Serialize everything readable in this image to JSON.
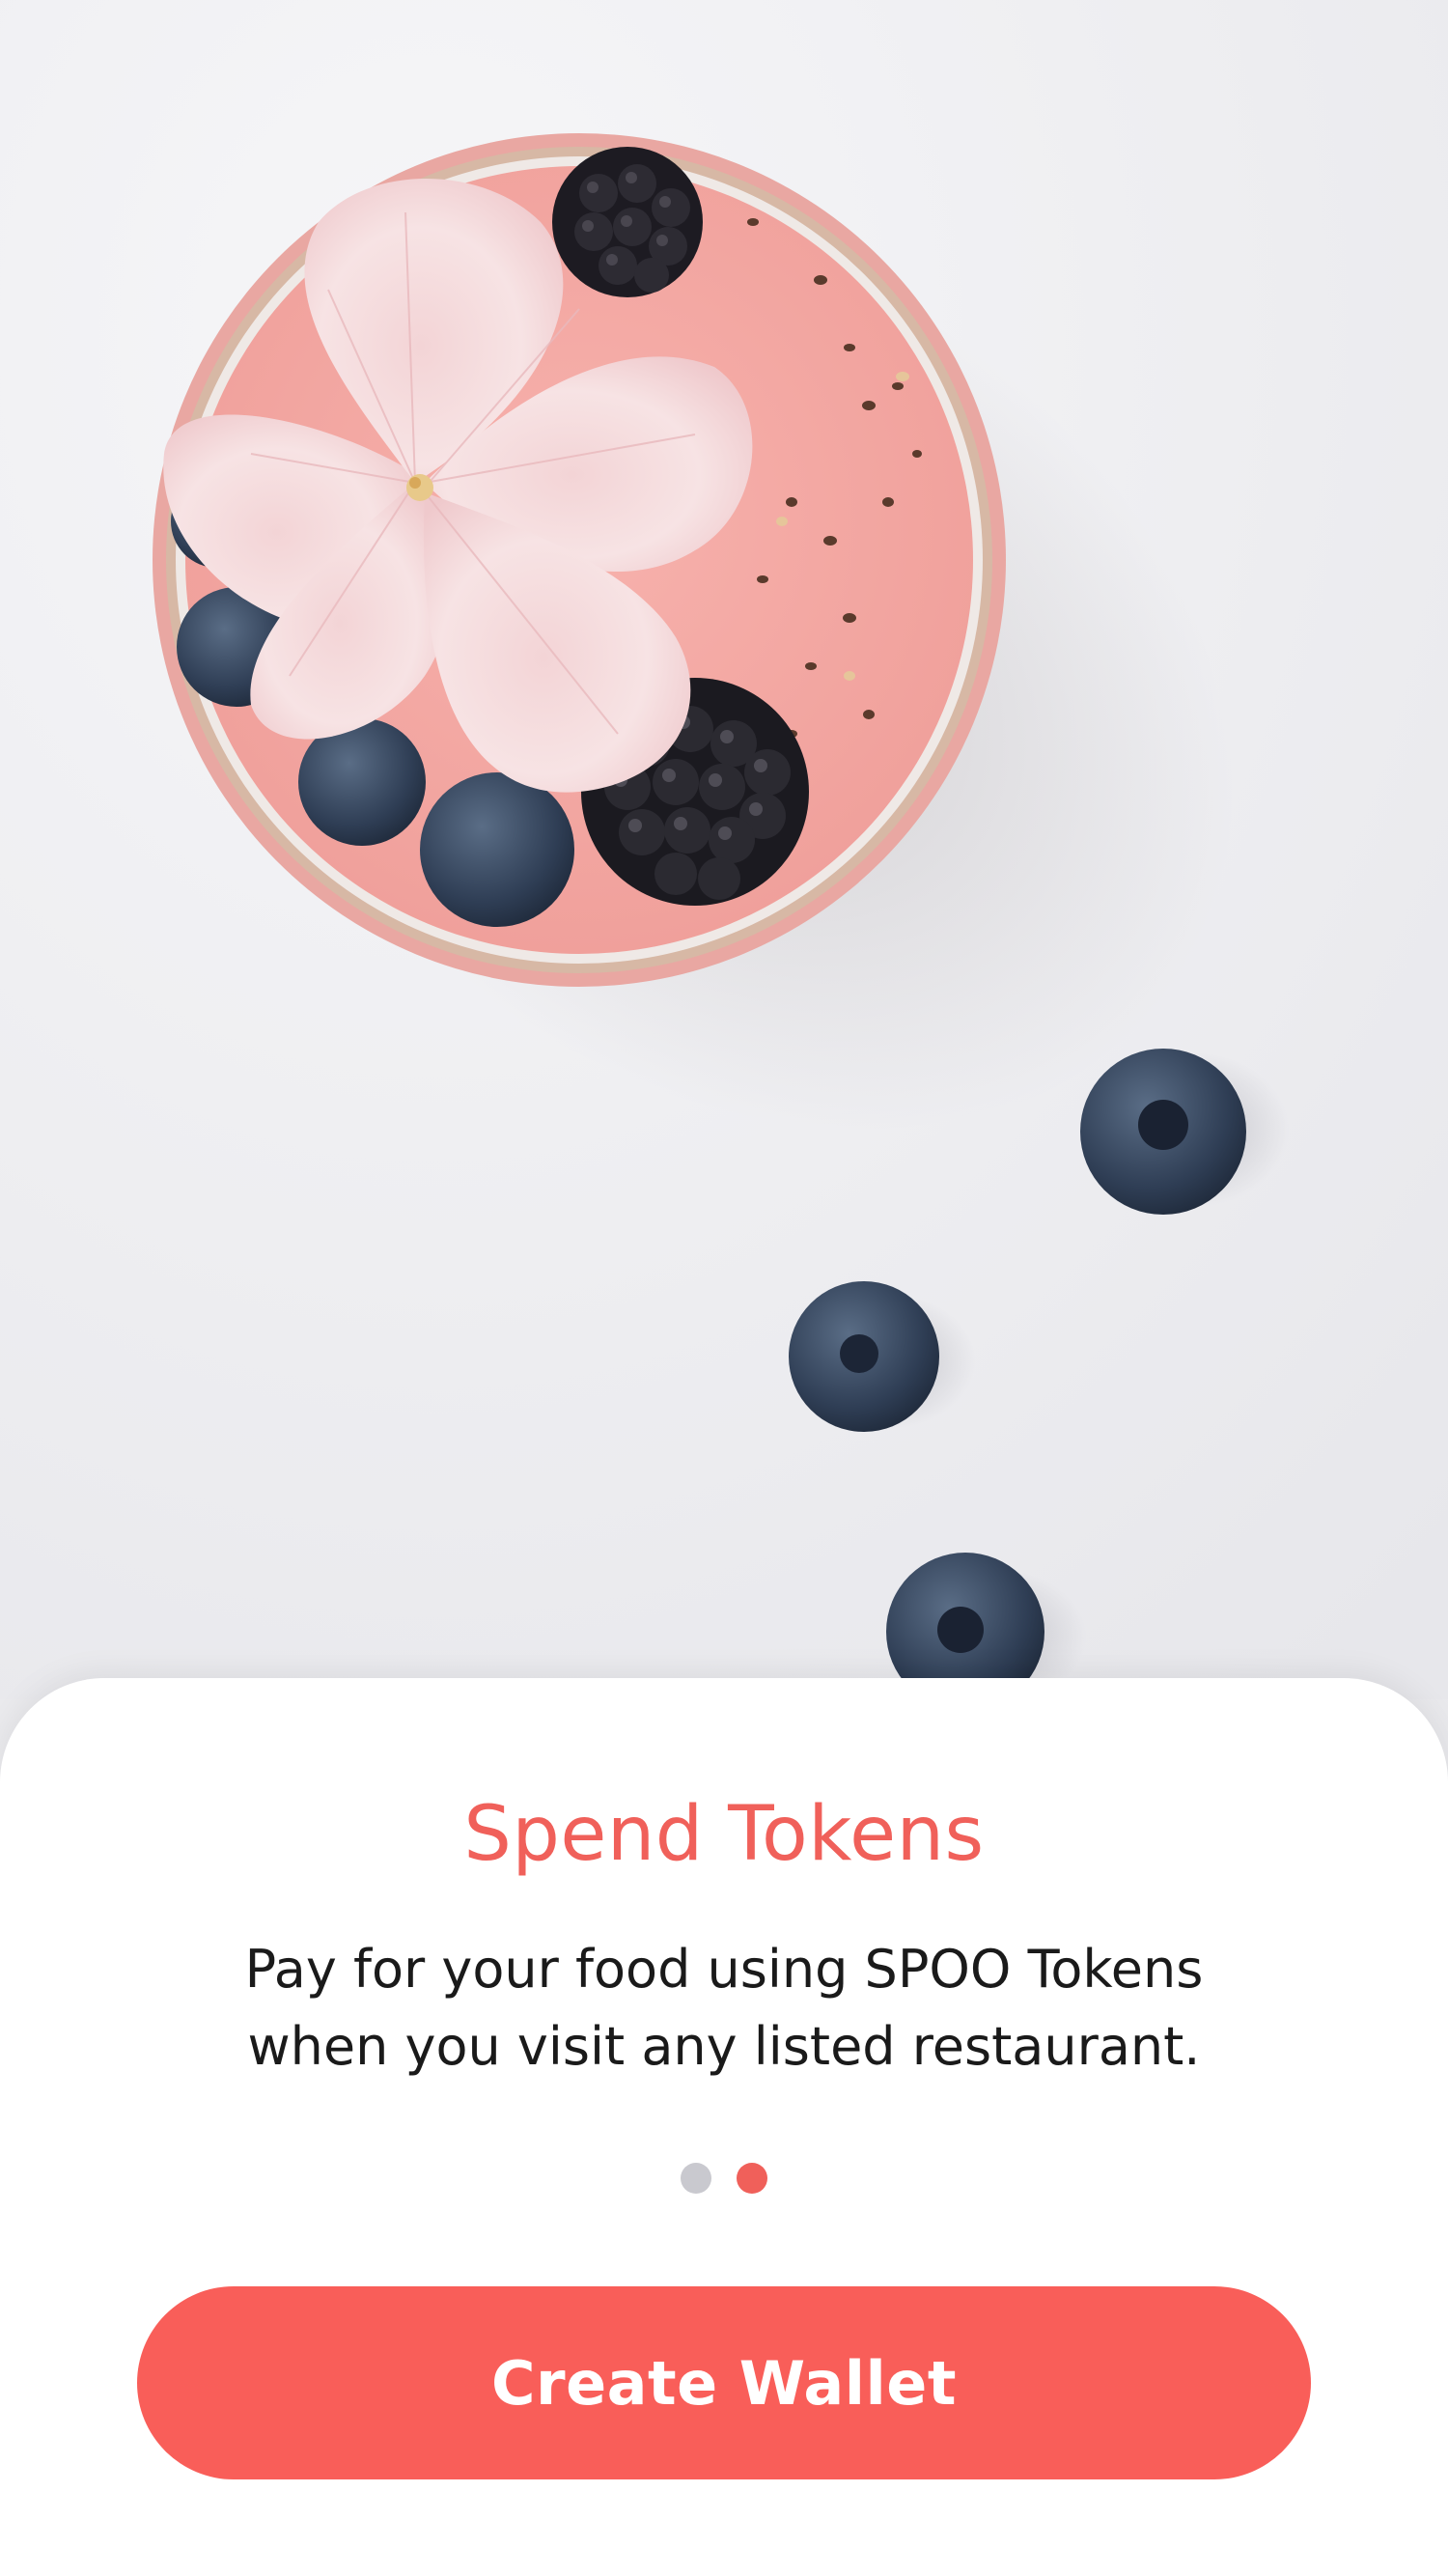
{
  "hero": {
    "icon": "smoothie-bowl-photo"
  },
  "onboarding": {
    "title": "Spend Tokens",
    "description_line1": "Pay for your food using SPOO Tokens",
    "description_line2": "when you visit any listed restaurant.",
    "page_indicator": {
      "total": 2,
      "current": 2,
      "active_color": "#f0605a",
      "inactive_color": "#c9c9cf"
    },
    "cta_label": "Create Wallet"
  },
  "colors": {
    "accent": "#f95e59",
    "title": "#f0605a"
  }
}
